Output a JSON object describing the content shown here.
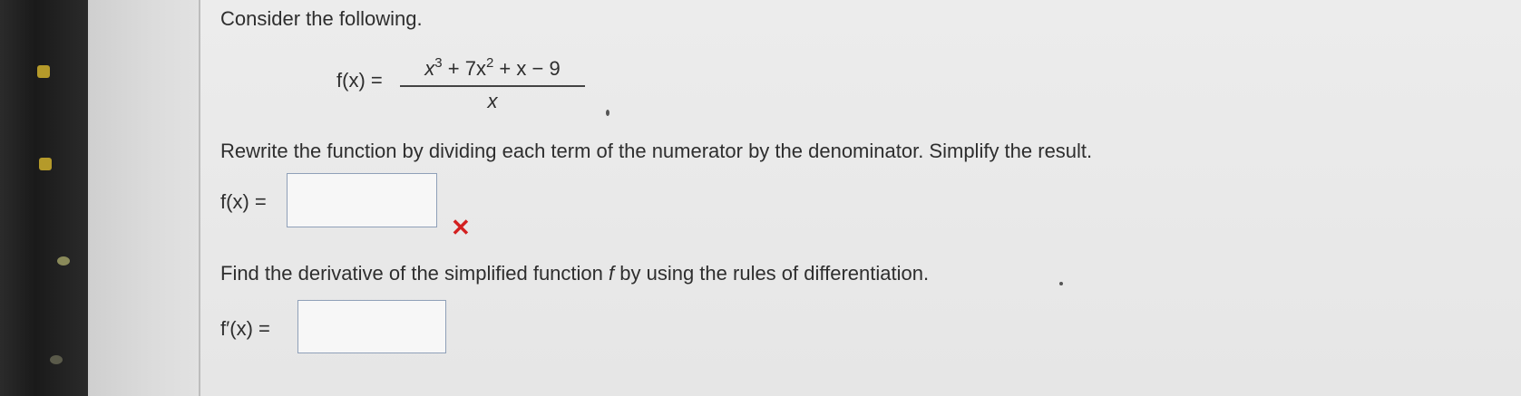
{
  "problem": {
    "intro": "Consider the following.",
    "function_label": "f(x) =",
    "numerator_parts": [
      "x",
      "3",
      " + 7x",
      "2",
      " + x − 9"
    ],
    "denominator": "x",
    "instruction_1": "Rewrite the function by dividing each term of the numerator by the denominator. Simplify the result.",
    "answer_1_label": "f(x) =",
    "answer_1_value": "",
    "answer_1_status": "✕",
    "instruction_2_before": "Find the derivative of the simplified function ",
    "instruction_2_var": "f",
    "instruction_2_after": " by using the rules of differentiation.",
    "answer_2_label": "f′(x) =",
    "answer_2_value": ""
  },
  "colors": {
    "incorrect": "#d32020",
    "input_border": "#8fa0b8"
  },
  "icons": [
    "side-icon",
    "incorrect-x-icon"
  ]
}
